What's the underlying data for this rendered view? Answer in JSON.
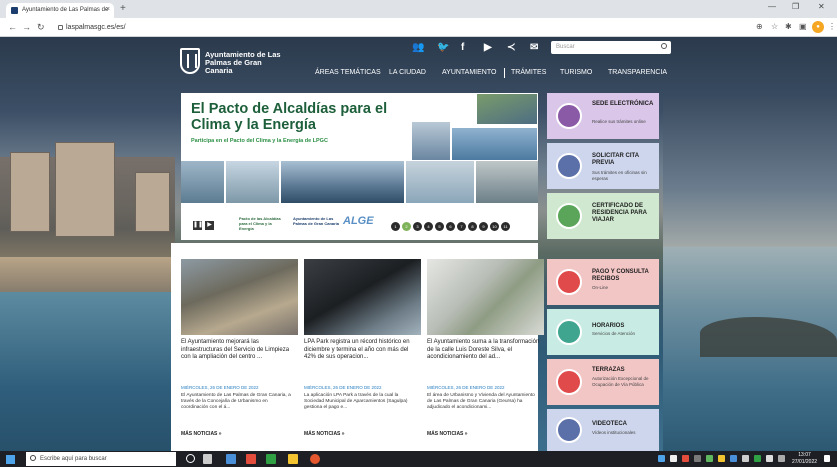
{
  "browser": {
    "tab_title": "Ayuntamiento de Las Palmas de",
    "url": "laspalmasgc.es/es/",
    "new_tab": "+",
    "tab_close": "×"
  },
  "site": {
    "logo": {
      "title": "Ayuntamiento de Las Palmas de Gran Canaria"
    },
    "social_icons": [
      "group-icon",
      "twitter-icon",
      "facebook-icon",
      "youtube-icon",
      "share-icon",
      "mail-icon"
    ],
    "search": {
      "placeholder": "Buscar"
    },
    "menu": [
      "ÁREAS TEMÁTICAS",
      "LA CIUDAD",
      "AYUNTAMIENTO",
      "TRÁMITES",
      "TURISMO",
      "TRANSPARENCIA"
    ]
  },
  "hero": {
    "title": "El Pacto de Alcaldías para el Clima y la Energía",
    "subtitle": "Participa en el Pacto del Clima y la Energía de LPGC",
    "partner_1": "Pacto de las Alcaldías para el Clima y la Energía",
    "partner_2": "Ayuntamiento de Las Palmas de Gran Canaria",
    "partner_3": "ALGE",
    "slides": [
      "1",
      "2",
      "3",
      "4",
      "5",
      "6",
      "7",
      "8",
      "9",
      "10",
      "11"
    ],
    "active_slide": 1,
    "pause": "❚❚",
    "play": "▶"
  },
  "tiles": [
    {
      "title": "SEDE ELECTRÓNICA",
      "desc": "Realice sus trámites online",
      "color": "#d9c6e8",
      "icon_color": "#8a5aa6"
    },
    {
      "title": "SOLICITAR CITA PREVIA",
      "desc": "Sus trámites en oficinas sin esperas",
      "color": "#cdd6ec",
      "icon_color": "#5b6fa8"
    },
    {
      "title": "CERTIFICADO DE RESIDENCIA PARA VIAJAR",
      "desc": "",
      "color": "#cfe8cf",
      "icon_color": "#5aa55a"
    },
    {
      "title": "PAGO Y CONSULTA RECIBOS",
      "desc": "On-Line",
      "color": "#f3c6c6",
      "icon_color": "#e04a4a"
    },
    {
      "title": "HORARIOS",
      "desc": "Servicios de Atención",
      "color": "#c8ece4",
      "icon_color": "#3fa58f"
    },
    {
      "title": "TERRAZAS",
      "desc": "Autorización Excepcional de Ocupación de Vía Pública",
      "color": "#f3c6c6",
      "icon_color": "#e04a4a"
    },
    {
      "title": "VIDEOTECA",
      "desc": "Vídeos institucionales",
      "color": "#cdd6ec",
      "icon_color": "#5b6fa8"
    }
  ],
  "news": [
    {
      "headline": "El Ayuntamiento mejorará las infraestructuras del Servicio de Limpieza con la ampliación del centro ...",
      "date": "MIÉRCOLES, 26 DE ENERO DE 2022",
      "lead": "El Ayuntamiento de Las Palmas de Gran Canaria, a través de la Concejalía de Urbanismo en coordinación con el á...",
      "more": "MÁS NOTICIAS »"
    },
    {
      "headline": "LPA Park registra un récord histórico en diciembre y termina el año con más del 42% de sus operacion...",
      "date": "MIÉRCOLES, 26 DE ENERO DE 2022",
      "lead": "La aplicación LPA Park a través de la cual la Sociedad Municipal de Aparcamientos (Sagulpa) gestiona el pago e...",
      "more": "MÁS NOTICIAS »"
    },
    {
      "headline": "El Ayuntamiento suma a la transformación de la calle Luis Doreste Silva, el acondicionamiento del ad...",
      "date": "MIÉRCOLES, 26 DE ENERO DE 2022",
      "lead": "El área de Urbanismo y Vivienda del Ayuntamiento de Las Palmas de Gran Canaria (Geursa) ha adjudicado el acondicionami...",
      "more": "MÁS NOTICIAS »"
    }
  ],
  "taskbar": {
    "search_placeholder": "Escribe aquí para buscar",
    "time": "13:07",
    "date": "27/01/2022"
  }
}
